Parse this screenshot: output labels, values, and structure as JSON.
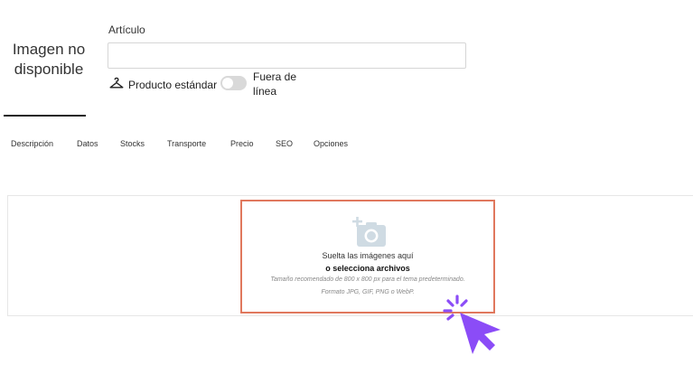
{
  "image_placeholder": {
    "text_line1": "Imagen no",
    "text_line2": "disponible"
  },
  "article": {
    "label": "Artículo",
    "value": ""
  },
  "product_type": {
    "label": "Producto estándar",
    "icon": "hanger-icon"
  },
  "discontinued_toggle": {
    "label_line1": "Fuera de",
    "label_line2": "línea",
    "on": false
  },
  "tabs": [
    {
      "label": "Descripción"
    },
    {
      "label": "Datos"
    },
    {
      "label": "Stocks"
    },
    {
      "label": "Transporte"
    },
    {
      "label": "Precio"
    },
    {
      "label": "SEO"
    },
    {
      "label": "Opciones"
    }
  ],
  "dropzone": {
    "title": "Suelta las imágenes aquí",
    "select_link": "o selecciona archivos",
    "hint_size": "Tamaño recomendado de 800 x 800 px para el tema predeterminado.",
    "hint_format": "Formato JPG, GIF, PNG o WebP.",
    "highlight_color": "#e0785d",
    "camera_icon": "add-camera-icon"
  },
  "pointer": {
    "icon": "click-cursor-icon",
    "color": "#8b4cf7"
  }
}
